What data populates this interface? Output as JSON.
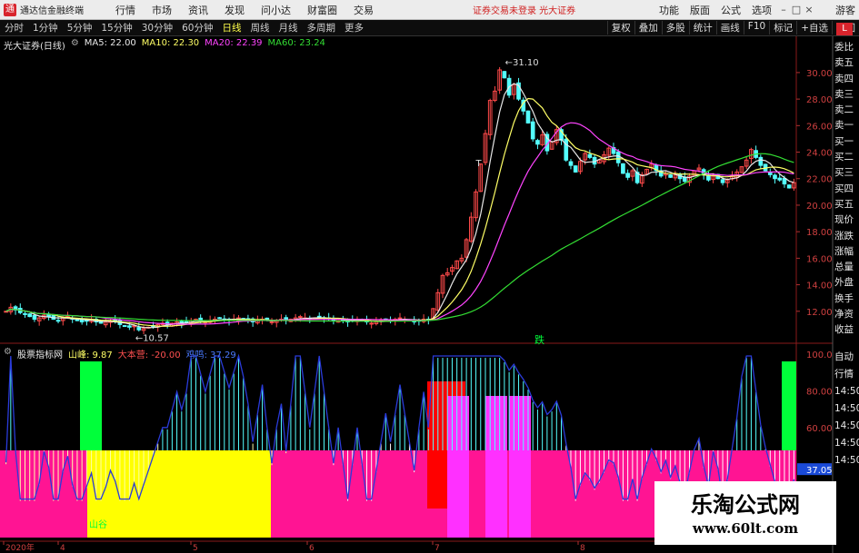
{
  "menubar": {
    "logo": "通",
    "app_title": "通达信金融终端",
    "items": [
      "行情",
      "市场",
      "资讯",
      "发现",
      "问小达",
      "财富圈",
      "交易"
    ],
    "notice": "证券交易未登录  光大证券",
    "right_items": [
      "功能",
      "版面",
      "公式",
      "选项"
    ],
    "guest": "游客"
  },
  "timeframes": [
    "分时",
    "1分钟",
    "5分钟",
    "15分钟",
    "30分钟",
    "60分钟",
    "日线",
    "周线",
    "月线",
    "多周期",
    "更多"
  ],
  "active_timeframe": "日线",
  "toolbar": [
    "复权",
    "叠加",
    "多股",
    "统计",
    "画线",
    "F10",
    "标记",
    "+自选",
    "返回"
  ],
  "side_tab": "L",
  "main_legend": {
    "title": "光大证券(日线)",
    "ma5": "MA5: 22.00",
    "ma10": "MA10: 22.30",
    "ma20": "MA20: 22.39",
    "ma60": "MA60: 23.24"
  },
  "sub_legend": {
    "title": "股票指标网",
    "shanfeng": "山峰: 9.87",
    "dabenying": "大本营: -20.00",
    "third": "鸡鸣: 37.29"
  },
  "side_panel": [
    "委比",
    "卖五",
    "卖四",
    "卖三",
    "卖二",
    "卖一",
    "买一",
    "买二",
    "买三",
    "买四",
    "买五",
    "现价",
    "涨跌",
    "涨幅",
    "总量",
    "外盘",
    "换手",
    "净资",
    "收益"
  ],
  "side_panel2": [
    "自动",
    "行情",
    "14:50",
    "14:50",
    "14:50",
    "14:50",
    "14:50"
  ],
  "price_axis": [
    "30.00",
    "28.00",
    "26.00",
    "24.00",
    "22.00",
    "20.00",
    "18.00",
    "16.00",
    "14.00",
    "12.00"
  ],
  "sub_axis": [
    "100.0",
    "80.00",
    "60.00",
    "37.05",
    "20.00"
  ],
  "annotations": {
    "high": "31.10",
    "low": "10.57",
    "t_mark": "T",
    "die": "跌",
    "shangu": "山谷"
  },
  "x_axis": [
    "2020年",
    "4",
    "5",
    "6",
    "7",
    "8"
  ],
  "watermark": {
    "line1": "乐淘公式网",
    "line2": "www.60lt.com"
  },
  "colors": {
    "up": "#ff4a4a",
    "down": "#54ffff",
    "ma5": "#e8e8e8",
    "ma10": "#ffff66",
    "ma20": "#ff44ff",
    "ma60": "#33dd33",
    "magenta": "#ff1493",
    "yellow": "#ffff00",
    "green": "#00ff3a"
  },
  "chart_data": {
    "type": "candlestick",
    "title": "光大证券(日线)",
    "ylim": [
      10,
      31.5
    ],
    "close_series": [
      12.0,
      12.3,
      12.1,
      11.9,
      11.8,
      11.6,
      11.4,
      11.5,
      11.7,
      11.6,
      11.4,
      11.3,
      11.5,
      11.6,
      11.4,
      11.3,
      11.2,
      11.3,
      11.4,
      11.2,
      11.1,
      11.2,
      11.3,
      11.2,
      11.0,
      10.9,
      10.8,
      10.9,
      10.6,
      10.7,
      10.8,
      10.9,
      11.0,
      11.1,
      11.0,
      11.1,
      11.2,
      11.1,
      11.2,
      11.3,
      11.4,
      11.3,
      11.2,
      11.3,
      11.4,
      11.5,
      11.4,
      11.3,
      11.4,
      11.5,
      11.4,
      11.3,
      11.2,
      11.3,
      11.4,
      11.3,
      11.2,
      11.3,
      11.4,
      11.3,
      11.4,
      11.5,
      11.6,
      11.5,
      11.4,
      11.5,
      11.6,
      11.5,
      11.4,
      11.3,
      11.4,
      11.3,
      11.2,
      11.3,
      11.4,
      11.3,
      11.2,
      11.1,
      11.2,
      11.3,
      11.4,
      11.3,
      11.4,
      11.5,
      11.4,
      11.3,
      11.2,
      11.3,
      11.4,
      11.3,
      12.2,
      13.4,
      14.7,
      14.9,
      15.3,
      15.8,
      16.0,
      17.4,
      19.1,
      21.0,
      23.1,
      25.4,
      27.9,
      28.6,
      30.2,
      29.6,
      28.3,
      29.1,
      28.0,
      27.1,
      26.2,
      25.0,
      24.6,
      25.3,
      24.1,
      24.8,
      25.7,
      24.9,
      23.4,
      23.0,
      22.5,
      23.3,
      23.9,
      23.6,
      23.1,
      23.4,
      23.8,
      24.3,
      23.9,
      23.2,
      22.4,
      22.1,
      22.6,
      21.7,
      22.3,
      22.7,
      23.1,
      22.6,
      22.2,
      22.4,
      22.1,
      22.3,
      22.0,
      21.8,
      22.2,
      22.6,
      22.8,
      22.3,
      21.9,
      22.2,
      22.0,
      21.7,
      21.9,
      22.2,
      22.5,
      22.9,
      23.4,
      24.2,
      23.6,
      23.0,
      22.6,
      22.3,
      22.0,
      21.9,
      21.6,
      21.3,
      21.7
    ],
    "ma60_end": 23.24,
    "high_label": 31.1,
    "low_label": 10.57,
    "sub_indicator": {
      "shanfeng": 9.87,
      "dabenying": -20.0,
      "jiming": 37.29,
      "current": 37.05,
      "ylim": [
        0,
        100
      ]
    }
  }
}
